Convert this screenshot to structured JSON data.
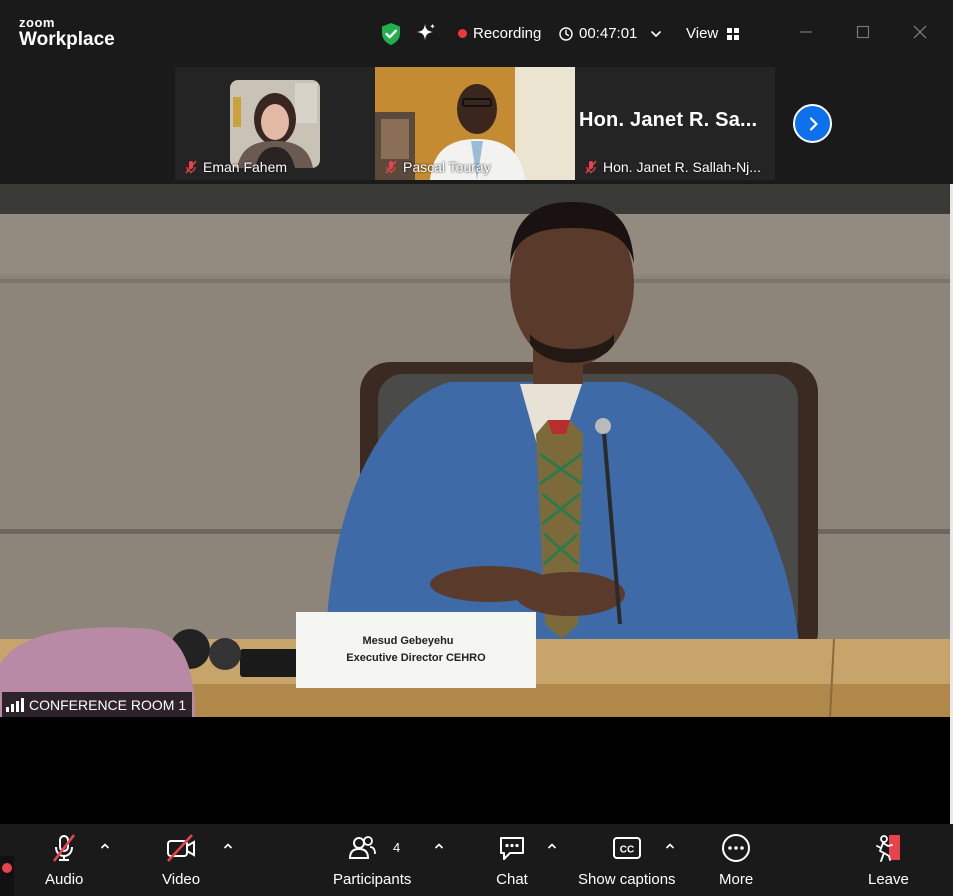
{
  "titlebar": {
    "brand_top": "zoom",
    "brand_bottom": "Workplace",
    "recording_label": "Recording",
    "timer": "00:47:01",
    "view_label": "View"
  },
  "thumbnails": [
    {
      "name": "Eman Fahem",
      "muted": true
    },
    {
      "name": "Pascal Touray",
      "muted": true
    },
    {
      "name": "Hon. Janet R. Sallah-Nj...",
      "display_name": "Hon. Janet R. Sa...",
      "muted": true
    }
  ],
  "main": {
    "speaker_name": "CONFERENCE ROOM 1",
    "placard_line1": "Mesud Gebeyehu",
    "placard_line2": "Executive Director CEHRO"
  },
  "toolbar": {
    "audio": "Audio",
    "video": "Video",
    "participants": "Participants",
    "participants_count": "4",
    "chat": "Chat",
    "captions": "Show captions",
    "more": "More",
    "leave": "Leave"
  },
  "colors": {
    "accent_blue": "#0e71eb",
    "recording_red": "#f0383a",
    "muted_red": "#e8424d",
    "shield_green": "#21b04b",
    "leave_red": "#e8424d"
  }
}
